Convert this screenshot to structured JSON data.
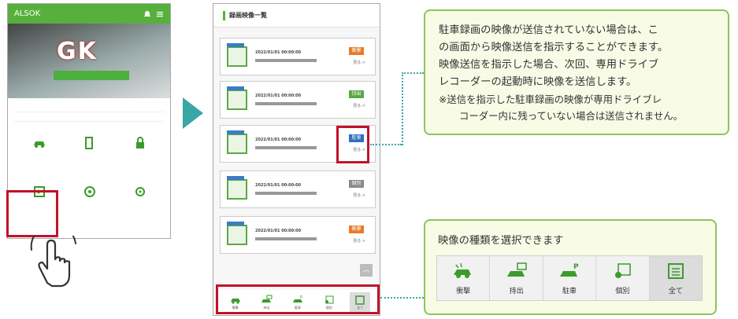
{
  "left_phone": {
    "appbar_title": "ALSOK",
    "appbar_icons": [
      "bell-icon",
      "menu-icon"
    ],
    "banner_logo": "GK",
    "grid_items": [
      {
        "icon": "car-impact-icon",
        "label": ""
      },
      {
        "icon": "door-icon",
        "label": ""
      },
      {
        "icon": "lock-icon",
        "label": ""
      },
      {
        "icon": "video-list-icon",
        "label": ""
      },
      {
        "icon": "steering-icon",
        "label": ""
      },
      {
        "icon": "settings-icon",
        "label": ""
      }
    ]
  },
  "right_phone": {
    "header_title": "録画映像一覧",
    "rows": [
      {
        "date": "2022/01/01 00:00:00",
        "place": "",
        "tag": "衝撃",
        "tag_color": "#e87b2a",
        "more": "見る >"
      },
      {
        "date": "2022/01/01 00:00:00",
        "place": "",
        "tag": "持出",
        "tag_color": "#5aa844",
        "more": "見る >"
      },
      {
        "date": "2022/01/01 00:00:00",
        "place": "",
        "tag": "駐車",
        "tag_color": "#2f6fc0",
        "more": "見る >"
      },
      {
        "date": "2022/01/01 00:00:00",
        "place": "",
        "tag": "個別",
        "tag_color": "#8a8a8a",
        "more": "見る >"
      },
      {
        "date": "2022/01/01 00:00:00",
        "place": "",
        "tag": "衝撃",
        "tag_color": "#e87b2a",
        "more": "見る >"
      }
    ],
    "scroll_top": "︿",
    "footer": [
      {
        "icon": "car-impact-icon",
        "label": "衝撃"
      },
      {
        "icon": "car-takeout-icon",
        "label": "持出"
      },
      {
        "icon": "car-park-icon",
        "label": "駐車"
      },
      {
        "icon": "individual-icon",
        "label": "個別"
      },
      {
        "icon": "all-icon",
        "label": "全て"
      }
    ]
  },
  "callout_top": {
    "line1": "駐車録画の映像が送信されていない場合は、こ",
    "line2": "の画面から映像送信を指示することができます。",
    "line3": "映像送信を指示した場合、次回、専用ドライブ",
    "line4": "レコーダーの起動時に映像を送信します。",
    "note1": "※送信を指示した駐車録画の映像が専用ドライブレ",
    "note2": "コーダー内に残っていない場合は送信されません。"
  },
  "callout_bottom": {
    "title": "映像の種類を選択できます",
    "buttons": [
      {
        "icon": "car-impact-icon",
        "label": "衝撃"
      },
      {
        "icon": "car-takeout-icon",
        "label": "持出"
      },
      {
        "icon": "car-park-icon",
        "label": "駐車"
      },
      {
        "icon": "individual-icon",
        "label": "個別"
      },
      {
        "icon": "all-icon",
        "label": "全て"
      }
    ]
  },
  "colors": {
    "accent_green": "#58b03c",
    "highlight_red": "#c0132a",
    "arrow_teal": "#3aa6a6",
    "callout_border": "#8bc75a"
  }
}
